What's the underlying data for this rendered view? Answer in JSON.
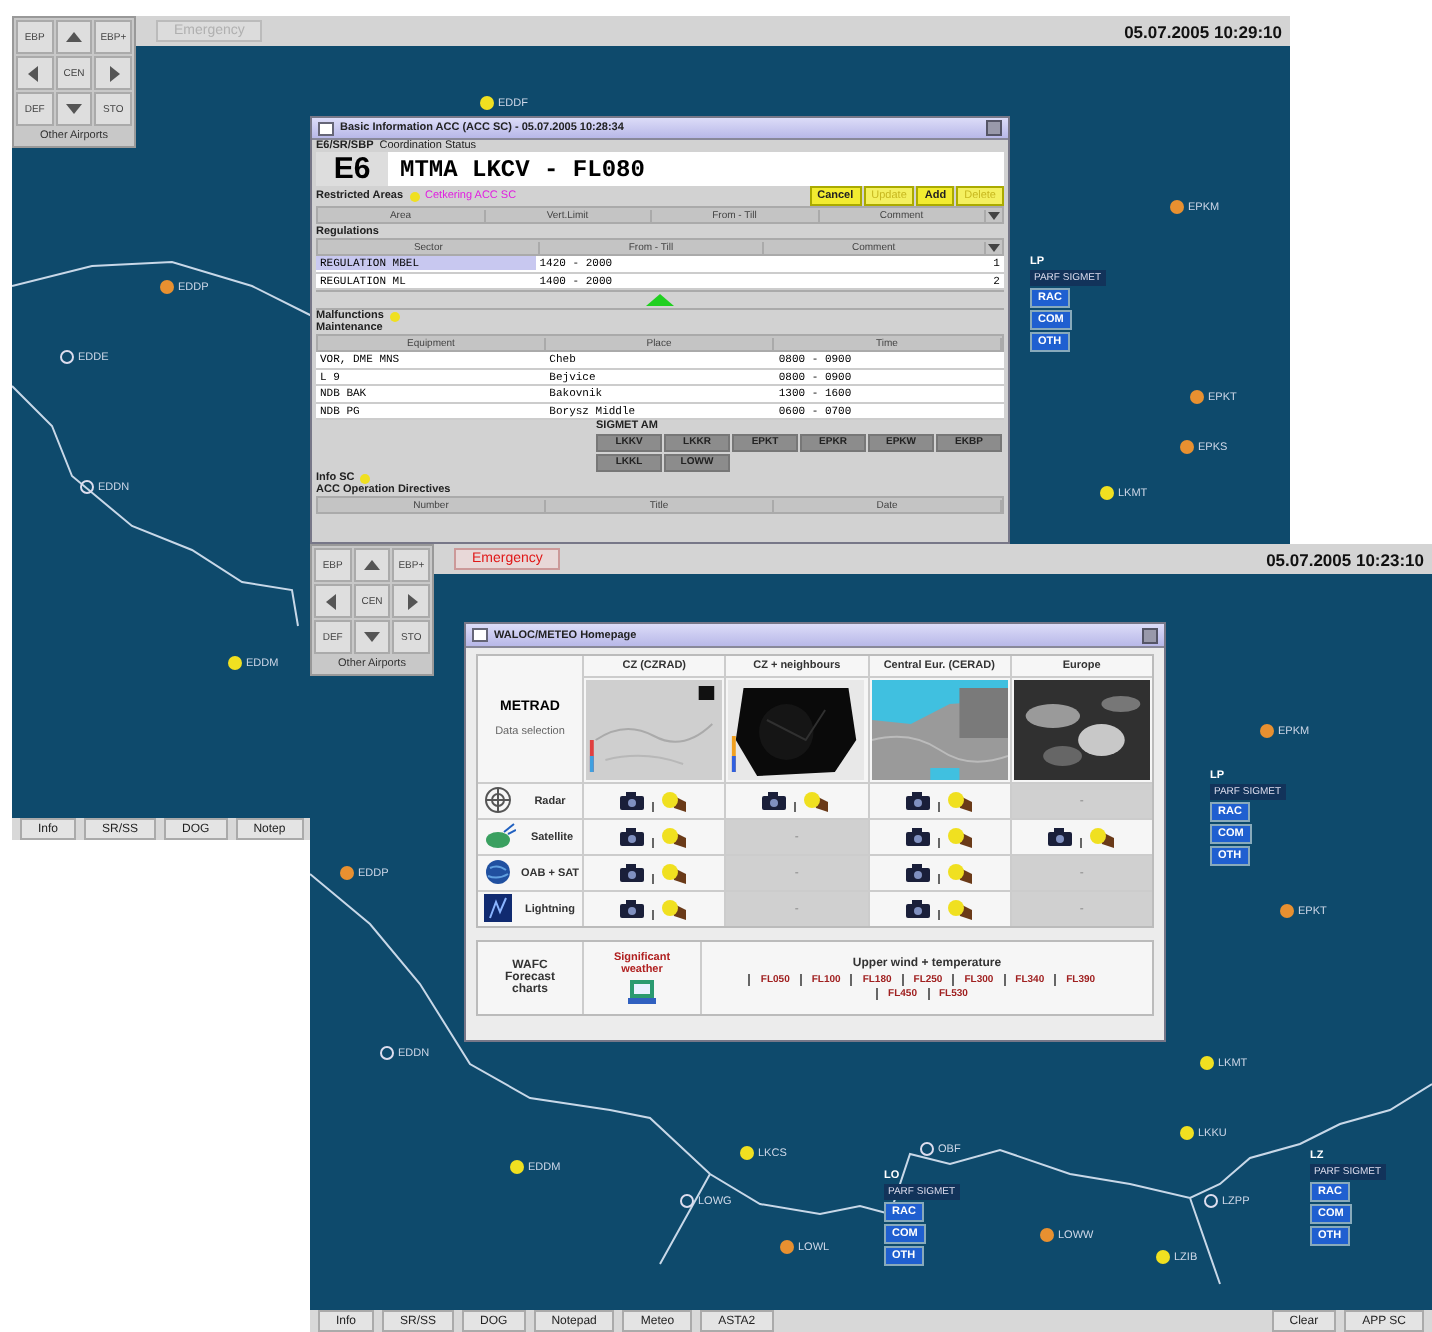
{
  "back_screen": {
    "top_bar": {
      "nav_pad": {
        "buttons": [
          {
            "kind": "text",
            "label": "EBP"
          },
          {
            "kind": "up"
          },
          {
            "kind": "text",
            "label": "EBP+"
          },
          {
            "kind": "left"
          },
          {
            "kind": "text",
            "label": "CEN"
          },
          {
            "kind": "right"
          },
          {
            "kind": "text",
            "label": "DEF"
          },
          {
            "kind": "down"
          },
          {
            "kind": "text",
            "label": "STO"
          }
        ],
        "footer": "Other Airports"
      },
      "emergency_button": {
        "label": "Emergency",
        "active": false
      },
      "datetime": "05.07.2005 10:29:10"
    },
    "map": {
      "markers": [
        {
          "code": "EDDF",
          "kind": "dot",
          "color": "#f0e020"
        },
        {
          "code": "EPKM",
          "kind": "dot",
          "color": "#e89030"
        },
        {
          "code": "EDDP",
          "kind": "dot",
          "color": "#e89030"
        },
        {
          "code": "EDDE",
          "kind": "ring"
        },
        {
          "code": "EDDN",
          "kind": "ring"
        },
        {
          "code": "EPKT",
          "kind": "dot",
          "color": "#e89030"
        },
        {
          "code": "EPKS",
          "kind": "dot",
          "color": "#e89030"
        },
        {
          "code": "LKMT",
          "kind": "dot",
          "color": "#f0e020"
        },
        {
          "code": "EDDM",
          "kind": "dot",
          "color": "#f0e020"
        }
      ],
      "info_panels": [
        {
          "header": "LP",
          "sigmet": "PARF SIGMET",
          "chips": [
            "RAC",
            "COM",
            "OTH"
          ]
        }
      ]
    },
    "bottom_bar": {
      "left_buttons": [
        "Info",
        "SR/SS",
        "DOG",
        "Notep"
      ]
    }
  },
  "basic_info_window": {
    "title": "Basic Information ACC (ACC SC) - 05.07.2005 10:28:34",
    "status_code": "E6/SR/SBP",
    "status_label": "Coordination Status",
    "sector": "E6",
    "coordination": "MTMA LKCV - FL080",
    "restricted_label": "Restricted Areas",
    "restricted_value": "Cetkering ACC SC",
    "buttons": [
      {
        "label": "Cancel",
        "disabled": false
      },
      {
        "label": "Update",
        "disabled": true
      },
      {
        "label": "Add",
        "disabled": false
      },
      {
        "label": "Delete",
        "disabled": true
      }
    ],
    "area_columns": [
      "Area",
      "Vert.Limit",
      "From - Till",
      "Comment"
    ],
    "regulations_label": "Regulations",
    "regulation_columns": [
      "Sector",
      "From - Till",
      "Comment"
    ],
    "regulations": [
      {
        "sector": "REGULATION MBEL",
        "time": "1420 - 2000",
        "count": "1",
        "selected": true
      },
      {
        "sector": "REGULATION ML",
        "time": "1400 - 2000",
        "count": "2",
        "selected": false
      }
    ],
    "malfunctions_label": "Malfunctions",
    "maintenance_label": "Maintenance",
    "maintenance_columns": [
      "Equipment",
      "Place",
      "Time"
    ],
    "maintenance": [
      {
        "equipment": "VOR, DME MNS",
        "place": "Cheb",
        "time": "0800 - 0900"
      },
      {
        "equipment": "L 9",
        "place": "Bejvice",
        "time": "0800 - 0900"
      },
      {
        "equipment": "NDB BAK",
        "place": "Bakovnik",
        "time": "1300 - 1600"
      },
      {
        "equipment": "NDB PG",
        "place": "Borysz Middle",
        "time": "0600 - 0700"
      }
    ],
    "sigmet_label": "SIGMET AM",
    "sigmet_chips": [
      "LKKV",
      "LKKR",
      "EPKT",
      "EPKR",
      "EPKW",
      "EKBP",
      "LKKL",
      "LOWW"
    ],
    "info_label": "Info SC",
    "directives_label": "ACC Operation Directives",
    "directive_columns": [
      "Number",
      "Title",
      "Date"
    ]
  },
  "front_screen": {
    "top_bar": {
      "nav_pad": {
        "buttons": [
          {
            "kind": "text",
            "label": "EBP"
          },
          {
            "kind": "up"
          },
          {
            "kind": "text",
            "label": "EBP+"
          },
          {
            "kind": "left"
          },
          {
            "kind": "text",
            "label": "CEN"
          },
          {
            "kind": "right"
          },
          {
            "kind": "text",
            "label": "DEF"
          },
          {
            "kind": "down"
          },
          {
            "kind": "text",
            "label": "STO"
          }
        ],
        "footer": "Other Airports"
      },
      "emergency_button": {
        "label": "Emergency",
        "active": true
      },
      "datetime": "05.07.2005 10:23:10"
    },
    "map": {
      "markers": [
        {
          "code": "EPKM",
          "kind": "dot",
          "color": "#e89030"
        },
        {
          "code": "EDDP",
          "kind": "dot",
          "color": "#e89030"
        },
        {
          "code": "EPKT",
          "kind": "dot",
          "color": "#e89030"
        },
        {
          "code": "LKMT",
          "kind": "dot",
          "color": "#f0e020"
        },
        {
          "code": "EDDN",
          "kind": "ring"
        },
        {
          "code": "EDDM",
          "kind": "dot",
          "color": "#f0e020"
        },
        {
          "code": "LKCS",
          "kind": "dot",
          "color": "#f0e020"
        },
        {
          "code": "OBF",
          "kind": "ring"
        },
        {
          "code": "LKKU",
          "kind": "dot",
          "color": "#f0e020"
        },
        {
          "code": "LOWG",
          "kind": "ring"
        },
        {
          "code": "LOWL",
          "kind": "dot",
          "color": "#e89030"
        },
        {
          "code": "LOWW",
          "kind": "dot",
          "color": "#e89030"
        },
        {
          "code": "LZIB",
          "kind": "dot",
          "color": "#f0e020"
        },
        {
          "code": "LZPP",
          "kind": "ring"
        }
      ],
      "info_panels": [
        {
          "header": "LP",
          "sigmet": "PARF SIGMET",
          "chips": [
            "RAC",
            "COM",
            "OTH"
          ]
        },
        {
          "header": "LO",
          "sigmet": "PARF SIGMET",
          "chips": [
            "RAC",
            "COM",
            "OTH"
          ]
        },
        {
          "header": "LZ",
          "sigmet": "PARF SIGMET",
          "chips": [
            "RAC",
            "COM",
            "OTH"
          ]
        }
      ]
    },
    "bottom_bar": {
      "left_buttons": [
        "Info",
        "SR/SS",
        "DOG",
        "Notepad",
        "Meteo",
        "ASTA2"
      ],
      "right_buttons": [
        "Clear",
        "APP SC"
      ]
    }
  },
  "meteo_window": {
    "title": "WALOC/METEO Homepage",
    "section_title": "METRAD",
    "section_link": "Data selection",
    "columns": [
      "CZ (CZRAD)",
      "CZ + neighbours",
      "Central Eur. (CERAD)",
      "Europe"
    ],
    "rows": [
      {
        "label": "Radar",
        "kind": "radar",
        "cells": [
          {
            "available": true
          },
          {
            "available": true
          },
          {
            "available": true
          },
          {
            "available": false,
            "text": "-"
          }
        ]
      },
      {
        "label": "Satellite",
        "kind": "satellite",
        "cells": [
          {
            "available": true
          },
          {
            "available": false,
            "text": "-"
          },
          {
            "available": true
          },
          {
            "available": true
          }
        ]
      },
      {
        "label": "OAB + SAT",
        "kind": "globe",
        "cells": [
          {
            "available": true
          },
          {
            "available": false,
            "text": "-"
          },
          {
            "available": true
          },
          {
            "available": false,
            "text": "-"
          }
        ]
      },
      {
        "label": "Lightning",
        "kind": "lightning",
        "cells": [
          {
            "available": true
          },
          {
            "available": false,
            "text": "-"
          },
          {
            "available": true
          },
          {
            "available": false,
            "text": "-"
          }
        ]
      }
    ],
    "wafc_label": "WAFC Forecast charts",
    "sigwx_label": "Significant weather",
    "upper_label": "Upper wind + temperature",
    "levels": [
      "FL050",
      "FL100",
      "FL180",
      "FL250",
      "FL300",
      "FL340",
      "FL390",
      "FL450",
      "FL530"
    ]
  }
}
